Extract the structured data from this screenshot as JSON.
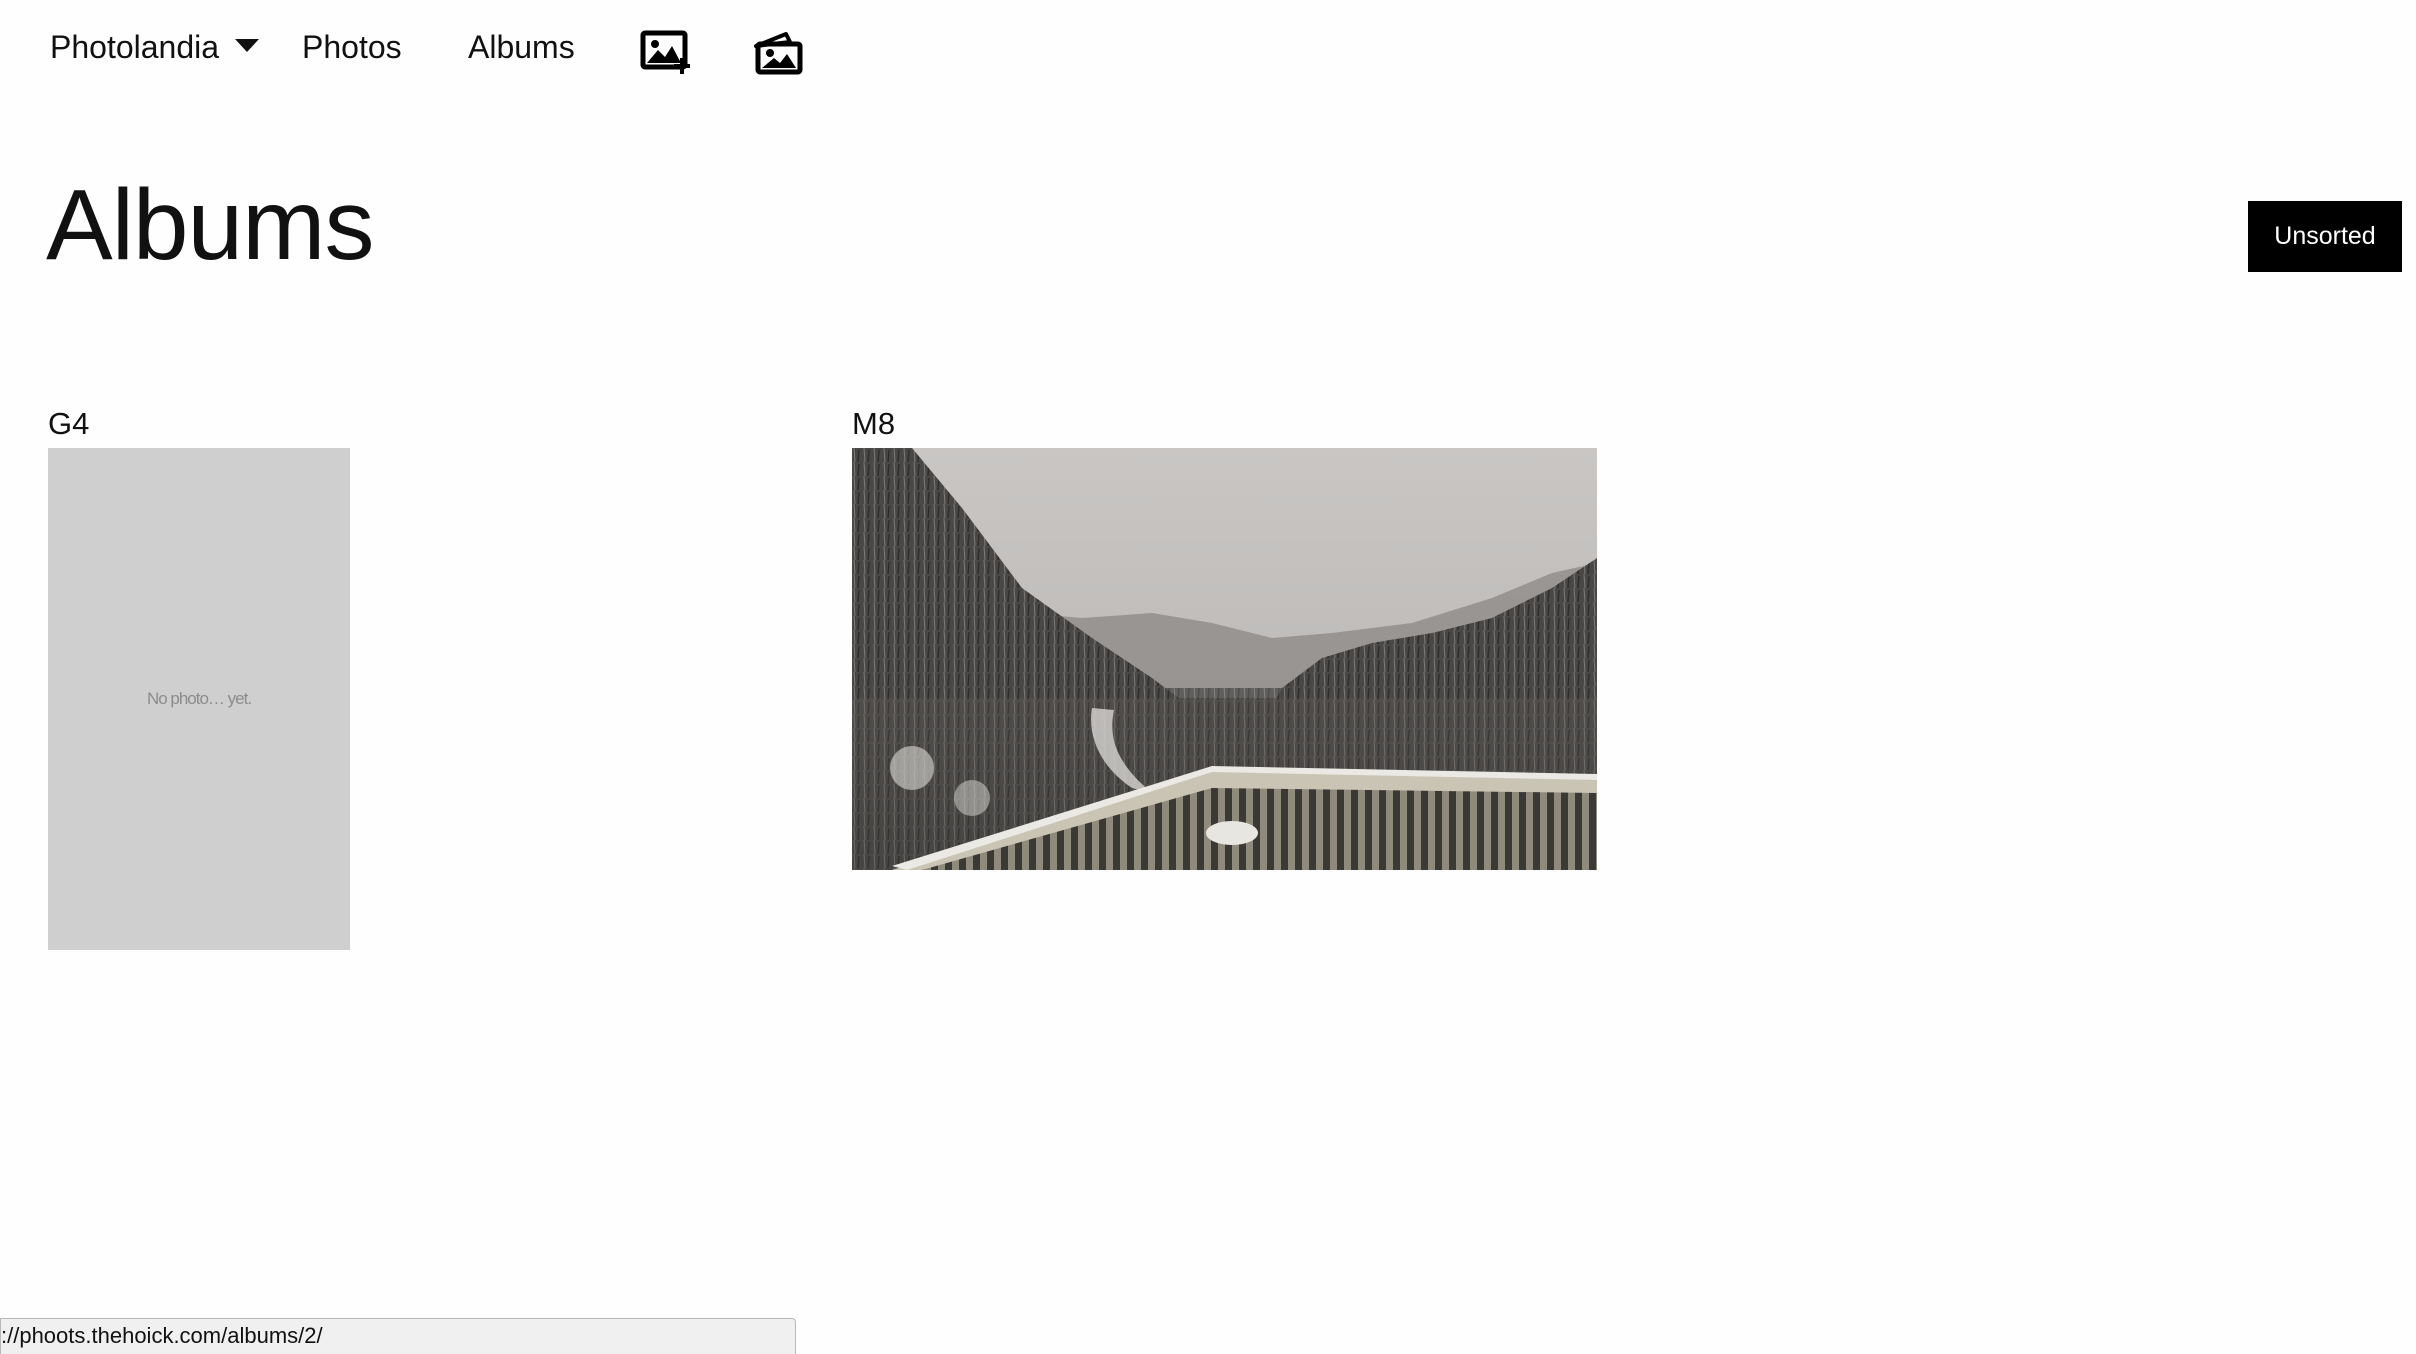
{
  "nav": {
    "brand": "Photolandia",
    "links": [
      {
        "label": "Photos"
      },
      {
        "label": "Albums"
      }
    ],
    "icons": [
      "add-photo-icon",
      "add-album-icon"
    ]
  },
  "header": {
    "title": "Albums",
    "sort_label": "Unsorted"
  },
  "albums": [
    {
      "title": "G4",
      "placeholder_text": "No photo… yet."
    },
    {
      "title": "M8"
    }
  ],
  "status_bar": {
    "url": "://phoots.thehoick.com/albums/2/"
  },
  "colors": {
    "button_bg": "#000000",
    "placeholder_bg": "#cfcfcf",
    "text": "#111111"
  }
}
